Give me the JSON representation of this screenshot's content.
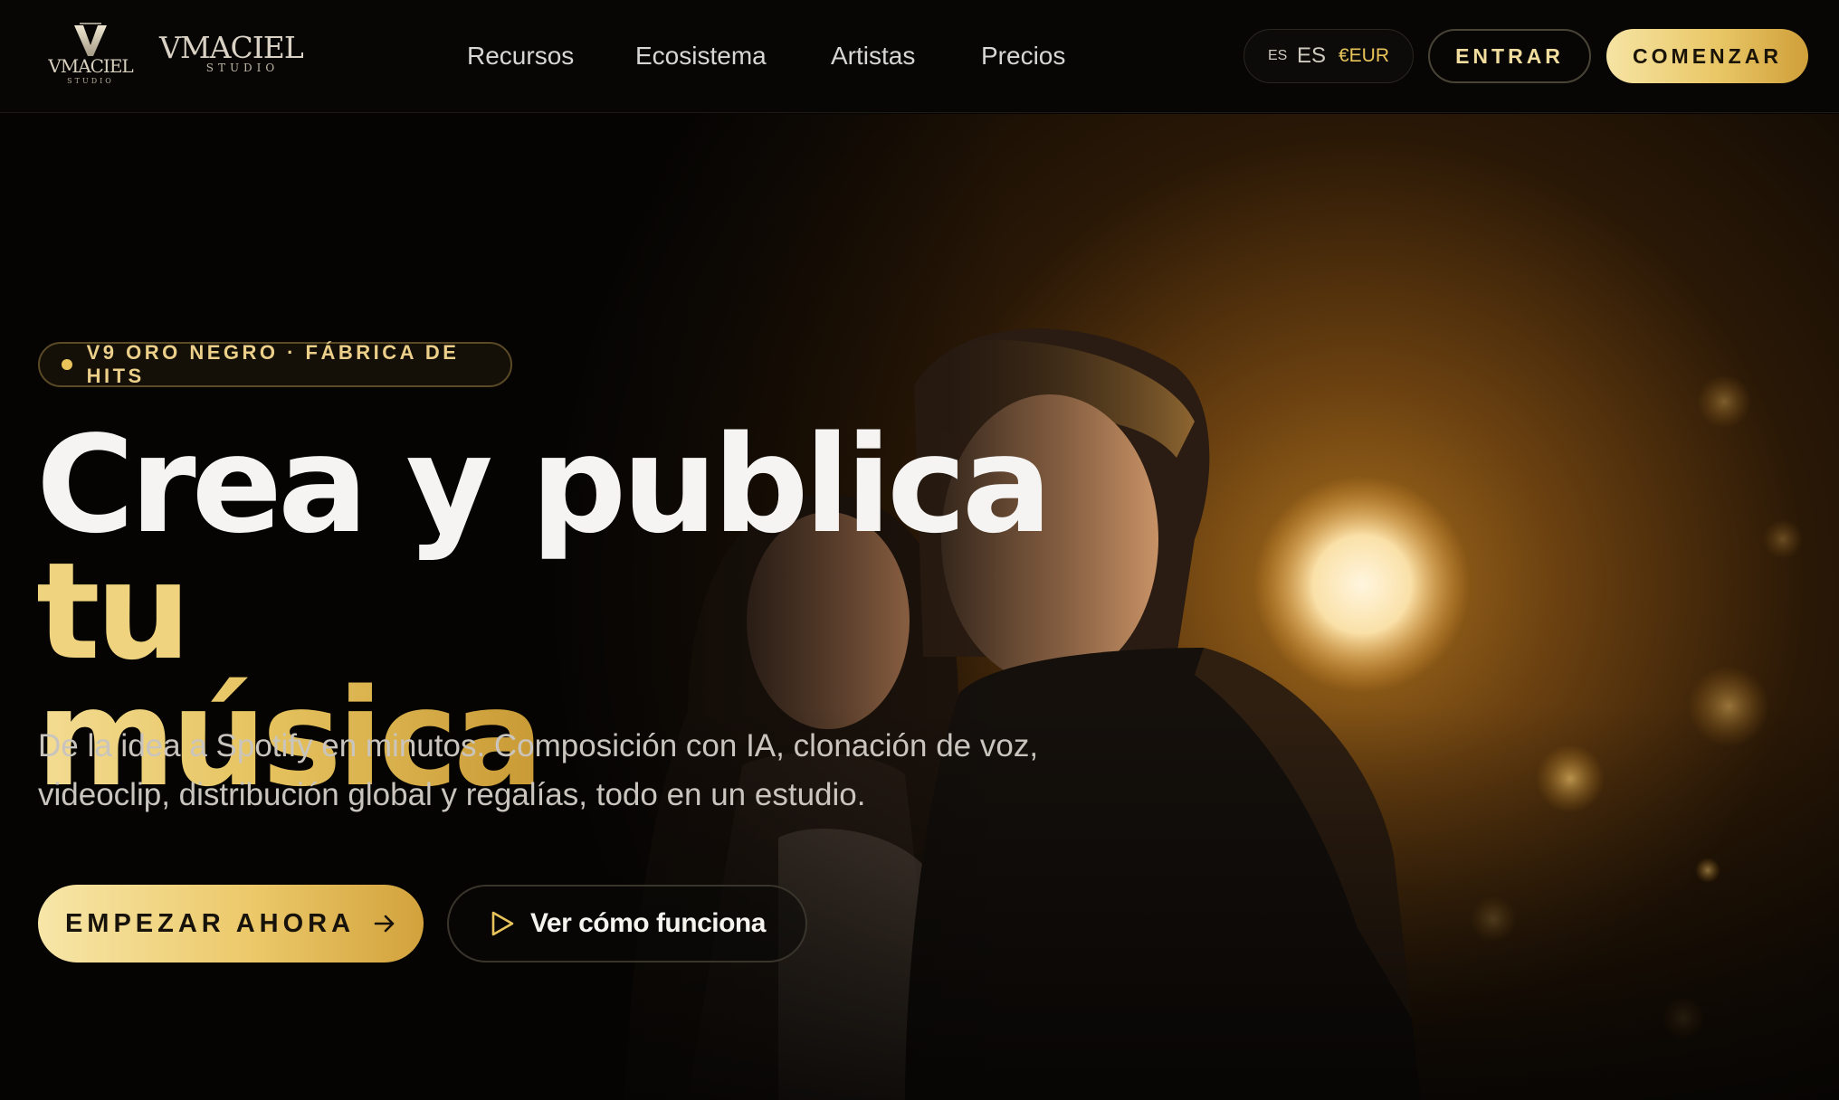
{
  "brand": {
    "mark_text": "VMACIEL",
    "mark_sub": "STUDIO",
    "wordmark": "VMACIEL",
    "wordmark_sub": "STUDIO"
  },
  "nav": {
    "items": [
      {
        "label": "Recursos"
      },
      {
        "label": "Ecosistema"
      },
      {
        "label": "Artistas"
      },
      {
        "label": "Precios"
      }
    ]
  },
  "locale": {
    "flag_code": "ES",
    "language": "ES",
    "currency": "€EUR"
  },
  "header_actions": {
    "login_label": "ENTRAR",
    "start_label": "COMENZAR"
  },
  "hero": {
    "badge": "V9 ORO NEGRO · FÁBRICA DE HITS",
    "headline": {
      "part1": "Crea y publica ",
      "part2": "tu",
      "part3": "música"
    },
    "subtitle_line1": "De la idea a Spotify en minutos. Composición con IA, clonación de voz,",
    "subtitle_line2": "videoclip, distribución global y regalías, todo en un estudio.",
    "cta_primary": "EMPEZAR AHORA",
    "cta_secondary": "Ver cómo funciona"
  },
  "colors": {
    "gold": "#e8c45a",
    "gold_light": "#f6e4a4",
    "background": "#050403",
    "text": "#f5f4f2"
  },
  "icons": {
    "cta_primary": "arrow-right-icon",
    "cta_secondary": "play-icon",
    "badge": "dot-icon"
  }
}
